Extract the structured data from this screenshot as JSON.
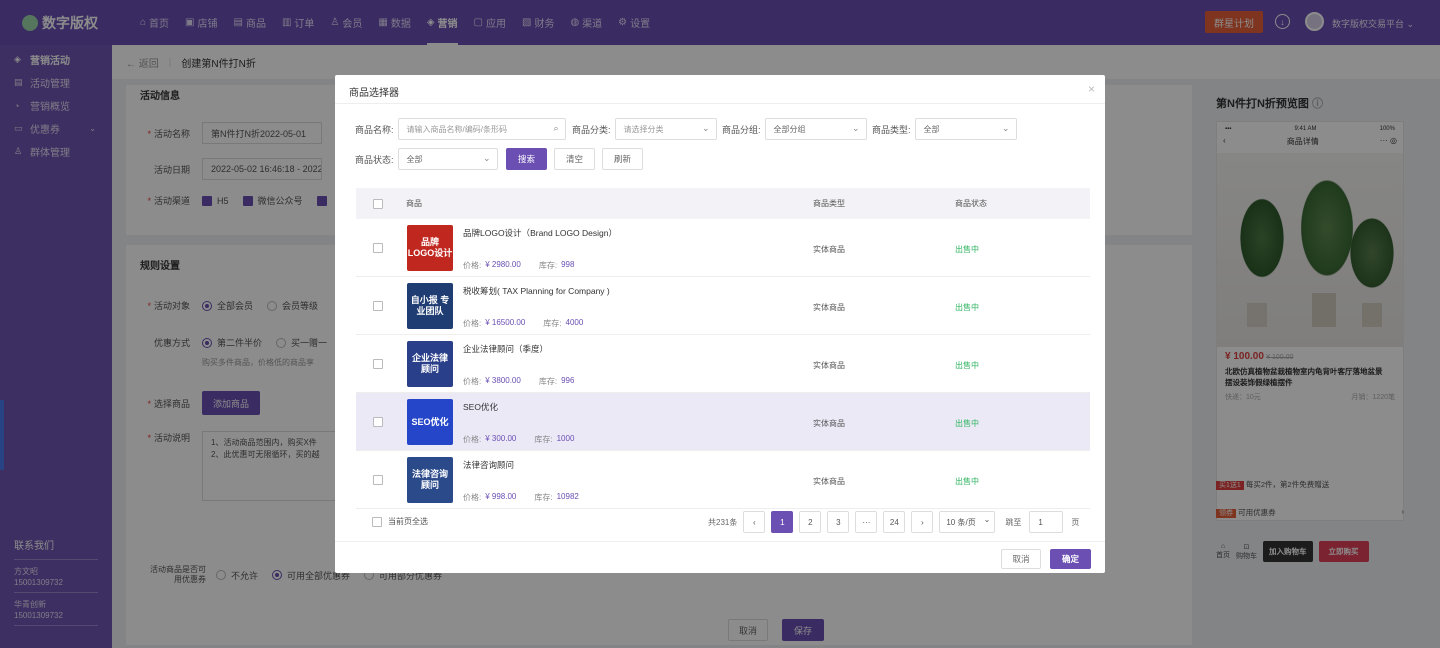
{
  "topbar": {
    "logo": "数字版权",
    "nav": [
      {
        "icon": "home-icon",
        "glyph": "⌂",
        "label": "首页"
      },
      {
        "icon": "store-icon",
        "glyph": "▣",
        "label": "店铺"
      },
      {
        "icon": "goods-icon",
        "glyph": "▤",
        "label": "商品"
      },
      {
        "icon": "order-icon",
        "glyph": "▥",
        "label": "订单"
      },
      {
        "icon": "member-icon",
        "glyph": "♙",
        "label": "会员"
      },
      {
        "icon": "data-icon",
        "glyph": "▦",
        "label": "数据"
      },
      {
        "icon": "tag-icon",
        "glyph": "◈",
        "label": "营销"
      },
      {
        "icon": "app-icon",
        "glyph": "▢",
        "label": "应用"
      },
      {
        "icon": "finance-icon",
        "glyph": "▧",
        "label": "财务"
      },
      {
        "icon": "channel-icon",
        "glyph": "◍",
        "label": "渠道"
      },
      {
        "icon": "settings-icon",
        "glyph": "⚙",
        "label": "设置"
      }
    ],
    "plan_button": "群星计划",
    "user_name": "数字版权交易平台 ⌄"
  },
  "sidebar": {
    "items": [
      {
        "icon": "tag-icon",
        "glyph": "◈",
        "label": "营销活动"
      },
      {
        "icon": "list-icon",
        "glyph": "▤",
        "label": "活动管理"
      },
      {
        "icon": "overview-icon",
        "glyph": "◔",
        "label": "营销概览"
      },
      {
        "icon": "coupon-icon",
        "glyph": "▭",
        "label": "优惠券"
      },
      {
        "icon": "group-icon",
        "glyph": "♙",
        "label": "群体管理"
      }
    ],
    "contact_title": "联系我们",
    "contacts": [
      {
        "name": "方文昭",
        "phone": "15001309732"
      },
      {
        "name": "华青创新",
        "phone": "15001309732"
      }
    ]
  },
  "breadcrumb": {
    "back": "← 返回",
    "title": "创建第N件打N折"
  },
  "form": {
    "section_basic": "活动信息",
    "name_label": "活动名称",
    "name_value": "第N件打N折2022-05-01",
    "date_label": "活动日期",
    "date_value": "2022-05-02 16:46:18 - 2022",
    "channel_label": "活动渠道",
    "channels": [
      "H5",
      "微信公众号"
    ],
    "section_rules": "规则设置",
    "target_label": "活动对象",
    "targets": [
      "全部会员",
      "会员等级"
    ],
    "discount_label": "优惠方式",
    "discounts": [
      "第二件半价",
      "买一赠一"
    ],
    "discount_hint": "购买多件商品，价格低的商品享",
    "select_label": "选择商品",
    "add_goods_button": "添加商品",
    "desc_label": "活动说明",
    "desc_lines": [
      "1、活动商品范围内，购买X件",
      "2、此优惠可无限循环，买的越"
    ],
    "coupon_label_1": "活动商品是否可",
    "coupon_label_2": "用优惠券",
    "coupon_options": [
      "不允许",
      "可用全部优惠券",
      "可用部分优惠券"
    ],
    "cancel_button": "取消",
    "save_button": "保存"
  },
  "preview": {
    "title": "第N件打N折预览图",
    "status_time": "9:41 AM",
    "status_battery": "100%",
    "page_title": "商品详情",
    "price": "¥ 100.00",
    "old_price": "¥ 100.00",
    "product_name": "北欧仿真植物盆栽植物室内龟背叶客厅落地盆景摆设装饰假绿植摆件",
    "shipping": "快递：10元",
    "sales": "月销：1220笔",
    "promo_badge": "买1送1",
    "promo_text": "每买2件，第2件免费赠送",
    "coupon_badge": "领券",
    "coupon_text": "可用优惠券",
    "home_label": "首页",
    "cart_label": "购物车",
    "add_cart_button": "加入购物车",
    "buy_button": "立即购买"
  },
  "modal": {
    "title": "商品选择器",
    "name_label": "商品名称:",
    "name_placeholder": "请输入商品名称/编码/条形码",
    "category_label": "商品分类:",
    "category_placeholder": "请选择分类",
    "group_label": "商品分组:",
    "group_value": "全部分组",
    "type_label": "商品类型:",
    "type_value": "全部",
    "status_label": "商品状态:",
    "status_value": "全部",
    "search_button": "搜索",
    "clear_button": "清空",
    "refresh_button": "刷新",
    "columns": [
      "商品",
      "商品类型",
      "商品状态"
    ],
    "rows": [
      {
        "name": "品牌LOGO设计（Brand LOGO Design）",
        "price": "¥ 2980.00",
        "stock": "998",
        "type": "实体商品",
        "status": "出售中",
        "thumb_text": "品牌 LOGO设计",
        "thumb_color": "#c0281f"
      },
      {
        "name": "税收筹划( TAX Planning for Company )",
        "price": "¥ 16500.00",
        "stock": "4000",
        "type": "实体商品",
        "status": "出售中",
        "thumb_text": "自小报 专业团队",
        "thumb_color": "#1f3d72"
      },
      {
        "name": "企业法律顾问（季度）",
        "price": "¥ 3800.00",
        "stock": "996",
        "type": "实体商品",
        "status": "出售中",
        "thumb_text": "企业法律 顾问",
        "thumb_color": "#2a3f8a"
      },
      {
        "name": "SEO优化",
        "price": "¥ 300.00",
        "stock": "1000",
        "type": "实体商品",
        "status": "出售中",
        "thumb_text": "SEO优化",
        "thumb_color": "#2546c9"
      },
      {
        "name": "法律咨询顾问",
        "price": "¥ 998.00",
        "stock": "10982",
        "type": "实体商品",
        "status": "出售中",
        "thumb_text": "法律咨询 顾问",
        "thumb_color": "#2a4a8a"
      }
    ],
    "price_label": "价格:",
    "stock_label": "库存:",
    "select_page_label": "当前页全选",
    "total": "共231条",
    "pages": [
      "1",
      "2",
      "3",
      "···",
      "24"
    ],
    "per_page": "10 条/页",
    "goto_label": "跳至",
    "goto_value": "1",
    "page_unit": "页",
    "cancel_button": "取消",
    "confirm_button": "确定",
    "highlight_row": 3
  }
}
